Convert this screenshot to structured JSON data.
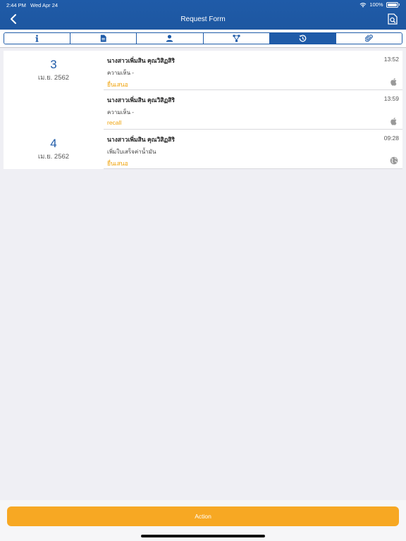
{
  "status_bar": {
    "time": "2:44 PM",
    "date": "Wed Apr 24",
    "battery": "100%"
  },
  "header": {
    "title": "Request Form"
  },
  "tabs": [
    {
      "icon": "info-icon"
    },
    {
      "icon": "document-icon"
    },
    {
      "icon": "person-icon"
    },
    {
      "icon": "flow-icon"
    },
    {
      "icon": "history-icon",
      "active": true
    },
    {
      "icon": "paperclip-icon"
    }
  ],
  "timeline": [
    {
      "day": "3",
      "month": "เม.ย. 2562",
      "entries": [
        {
          "name": "นางสาวเพิ่มสิน คุณวิสิฏสิริ",
          "time": "13:52",
          "comment": "ความเห็น -",
          "status": "ยื่นเสนอ",
          "device": "apple-icon"
        },
        {
          "name": "นางสาวเพิ่มสิน คุณวิสิฏสิริ",
          "time": "13:59",
          "comment": "ความเห็น -",
          "status": "recall",
          "device": "apple-icon"
        }
      ]
    },
    {
      "day": "4",
      "month": "เม.ย. 2562",
      "entries": [
        {
          "name": "นางสาวเพิ่มสิน คุณวิสิฏสิริ",
          "time": "09:28",
          "comment": "เพิ่มใบเสร็จค่าน้ำมัน",
          "status": "ยื่นเสนอ",
          "device": "globe-icon"
        }
      ]
    }
  ],
  "action": {
    "label": "Action"
  },
  "colors": {
    "primary": "#1f5ba8",
    "accent": "#f7a823",
    "status": "#f0a30a"
  }
}
